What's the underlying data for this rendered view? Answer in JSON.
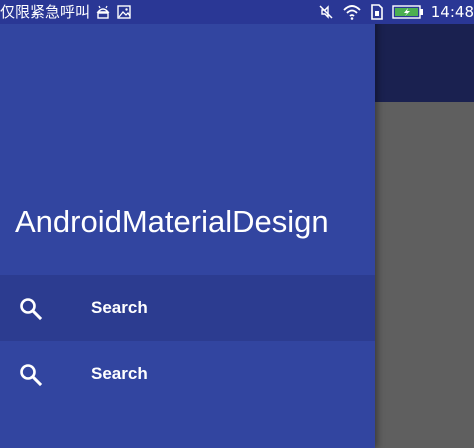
{
  "status_bar": {
    "left_text": "仅限紧急呼叫",
    "time": "14:48",
    "left_icons": [
      "android-icon",
      "image-icon"
    ],
    "right_icons": [
      "mute-icon",
      "wifi-icon",
      "sim-icon",
      "battery-charging-icon"
    ]
  },
  "drawer": {
    "title": "AndroidMaterialDesign",
    "items": [
      {
        "label": "Search",
        "icon": "search-icon",
        "selected": true
      },
      {
        "label": "Search",
        "icon": "search-icon",
        "selected": false
      }
    ]
  },
  "colors": {
    "drawer_background": "#3245a0",
    "selected_item": "#2c3c90",
    "status_bar": "#2a3795",
    "scrim_toolbar": "#1a2150",
    "scrim_content": "#5f5f5f",
    "battery_fill": "#4caf50"
  }
}
